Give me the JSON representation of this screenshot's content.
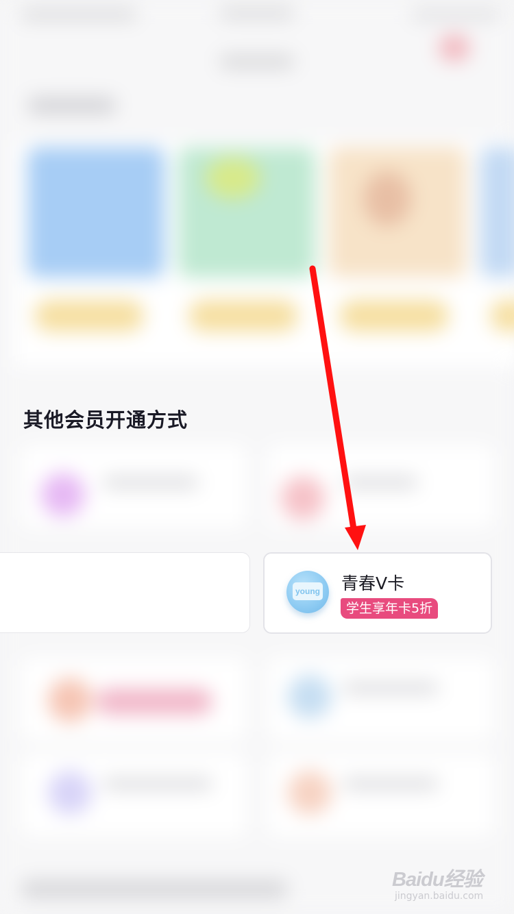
{
  "section": {
    "title": "其他会员开通方式"
  },
  "youth_card": {
    "logo_text": "young",
    "title": "青春V卡",
    "tag": "学生享年卡5折",
    "tag_color": "#e84b7e"
  },
  "annotation": {
    "arrow_color": "#ff1111"
  },
  "watermark": {
    "brand": "Baidu经验",
    "url": "jingyan.baidu.com"
  }
}
